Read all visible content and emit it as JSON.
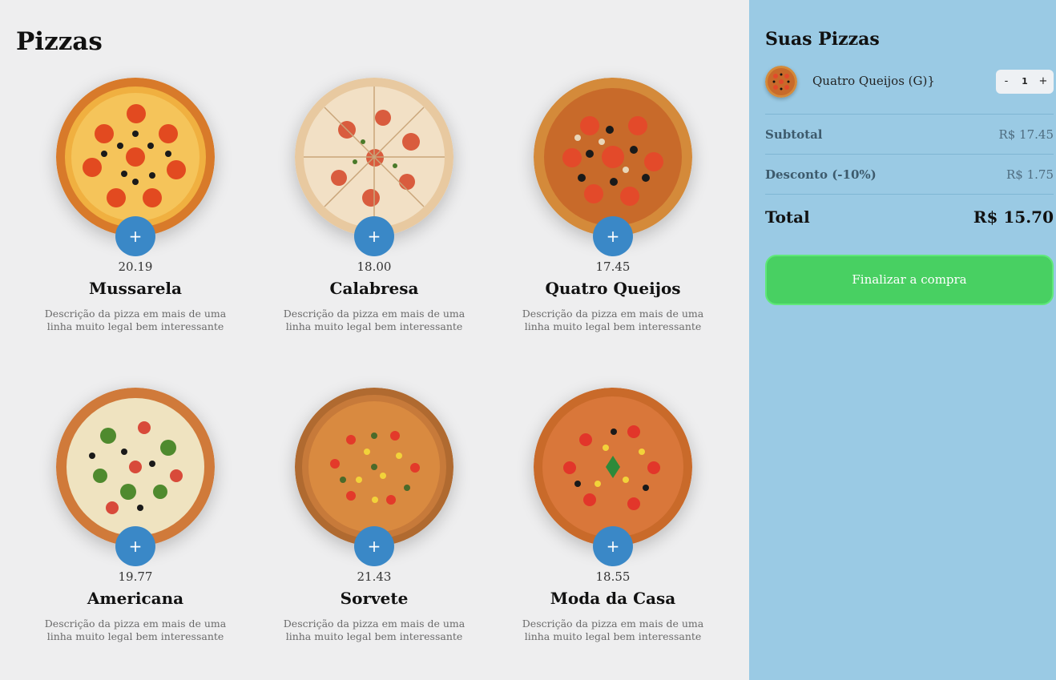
{
  "menu": {
    "title": "Pizzas",
    "add_label": "+",
    "pizzas": [
      {
        "name": "Mussarela",
        "price": "20.19",
        "description": "Descrição da pizza em mais de uma linha muito legal bem interessante",
        "icon": "pizza-mussarela-image"
      },
      {
        "name": "Calabresa",
        "price": "18.00",
        "description": "Descrição da pizza em mais de uma linha muito legal bem interessante",
        "icon": "pizza-calabresa-image"
      },
      {
        "name": "Quatro Queijos",
        "price": "17.45",
        "description": "Descrição da pizza em mais de uma linha muito legal bem interessante",
        "icon": "pizza-quatro-queijos-image"
      },
      {
        "name": "Americana",
        "price": "19.77",
        "description": "Descrição da pizza em mais de uma linha muito legal bem interessante",
        "icon": "pizza-americana-image"
      },
      {
        "name": "Sorvete",
        "price": "21.43",
        "description": "Descrição da pizza em mais de uma linha muito legal bem interessante",
        "icon": "pizza-sorvete-image"
      },
      {
        "name": "Moda da Casa",
        "price": "18.55",
        "description": "Descrição da pizza em mais de uma linha muito legal bem interessante",
        "icon": "pizza-moda-da-casa-image"
      }
    ]
  },
  "cart": {
    "title": "Suas Pizzas",
    "items": [
      {
        "name": "Quatro Queijos (G)}",
        "quantity": "1",
        "minus_label": "-",
        "plus_label": "+"
      }
    ],
    "subtotal_label": "Subtotal",
    "subtotal_value": "R$ 17.45",
    "discount_label": "Desconto (-10%)",
    "discount_value": "R$ 1.75",
    "total_label": "Total",
    "total_value": "R$ 15.70",
    "checkout_label": "Finalizar a compra"
  },
  "colors": {
    "accent": "#3a88c7",
    "sidebar_bg": "#9acae4",
    "checkout_bg": "#48d062",
    "page_bg": "#eeeeef"
  }
}
